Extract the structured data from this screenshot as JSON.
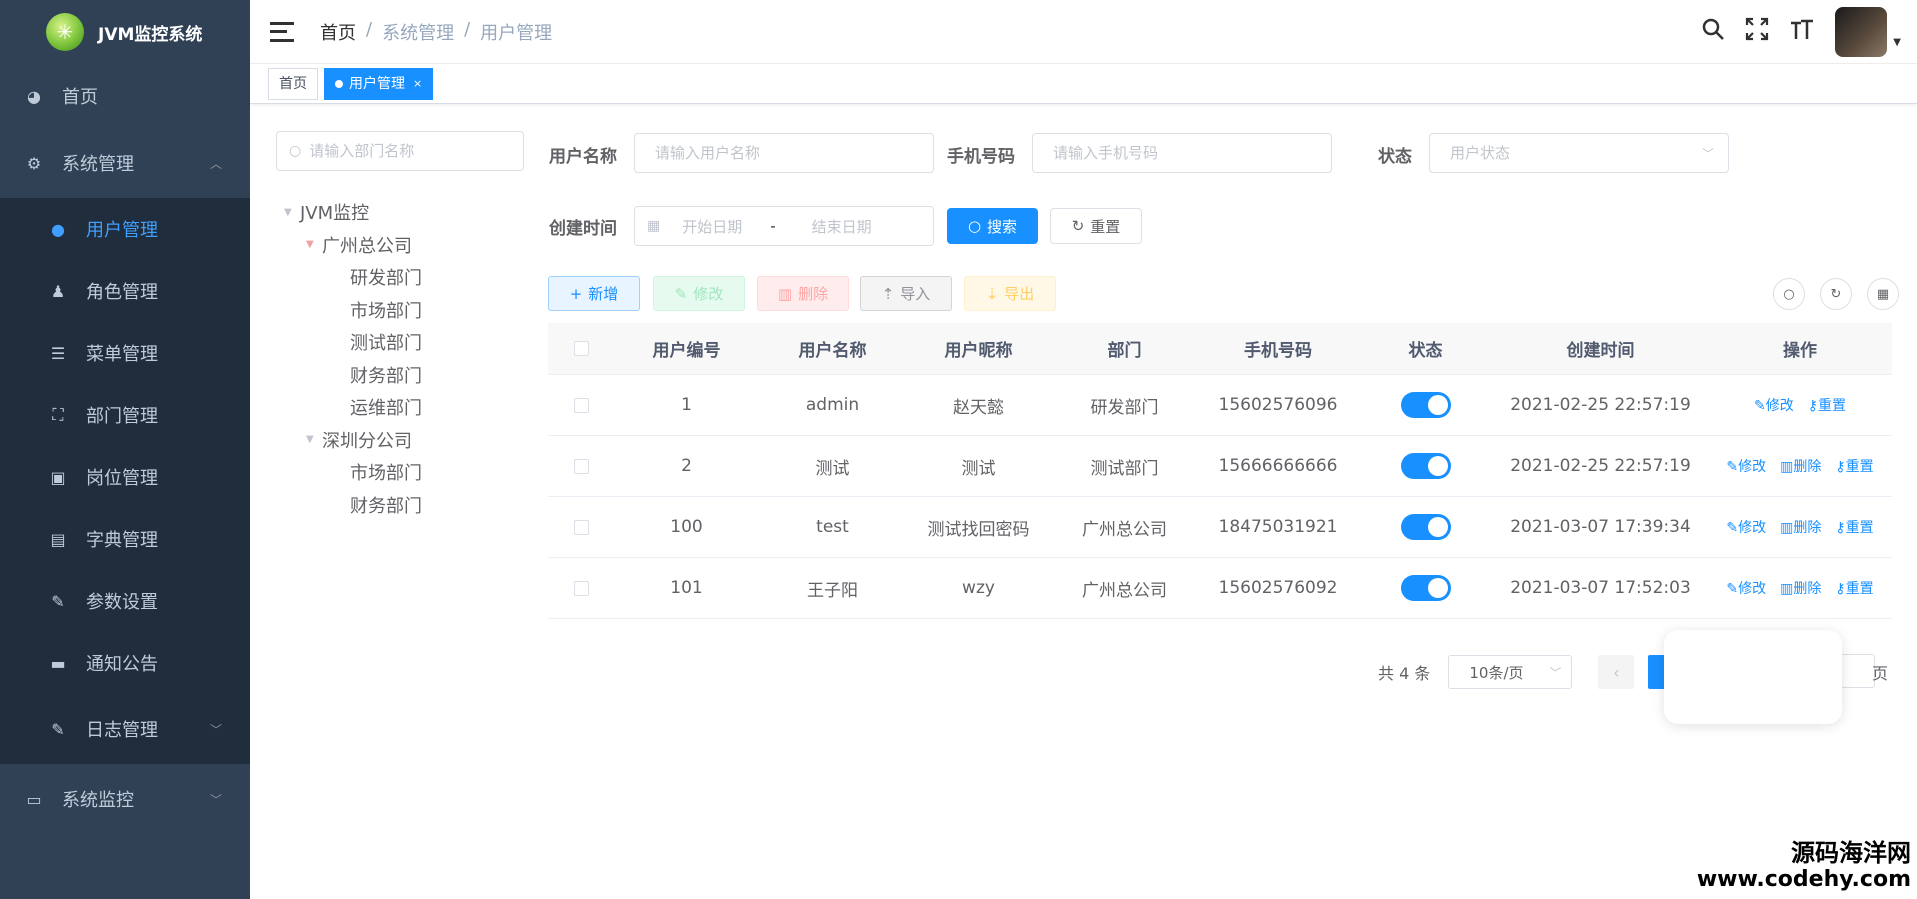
{
  "app": {
    "title": "JVM监控系统"
  },
  "sidebar": {
    "home": "首页",
    "system": "系统管理",
    "items": [
      {
        "label": "用户管理",
        "icon": "user-icon"
      },
      {
        "label": "角色管理",
        "icon": "role-icon"
      },
      {
        "label": "菜单管理",
        "icon": "menu-tree-icon"
      },
      {
        "label": "部门管理",
        "icon": "org-icon"
      },
      {
        "label": "岗位管理",
        "icon": "post-icon"
      },
      {
        "label": "字典管理",
        "icon": "dict-icon"
      },
      {
        "label": "参数设置",
        "icon": "edit-icon"
      },
      {
        "label": "通知公告",
        "icon": "message-icon"
      },
      {
        "label": "日志管理",
        "icon": "log-icon"
      }
    ],
    "monitor": "系统监控"
  },
  "breadcrumb": {
    "home": "首页",
    "sep": "/",
    "level1": "系统管理",
    "level2": "用户管理"
  },
  "tags": {
    "home": "首页",
    "current": "用户管理",
    "close": "×"
  },
  "tree": {
    "search_placeholder": "请输入部门名称",
    "nodes": {
      "root": "JVM监控",
      "gz": "广州总公司",
      "gz_rd": "研发部门",
      "gz_mk": "市场部门",
      "gz_qa": "测试部门",
      "gz_fin": "财务部门",
      "gz_ops": "运维部门",
      "sz": "深圳分公司",
      "sz_mk": "市场部门",
      "sz_fin": "财务部门"
    }
  },
  "form": {
    "username_label": "用户名称",
    "username_placeholder": "请输入用户名称",
    "phone_label": "手机号码",
    "phone_placeholder": "请输入手机号码",
    "status_label": "状态",
    "status_placeholder": "用户状态",
    "created_label": "创建时间",
    "start_placeholder": "开始日期",
    "range_sep": "-",
    "end_placeholder": "结束日期",
    "search_btn": "搜索",
    "reset_btn": "重置"
  },
  "toolbar": {
    "add": "新增",
    "edit": "修改",
    "delete": "删除",
    "import": "导入",
    "export": "导出"
  },
  "table": {
    "headers": {
      "id": "用户编号",
      "name": "用户名称",
      "nick": "用户昵称",
      "dept": "部门",
      "phone": "手机号码",
      "status": "状态",
      "time": "创建时间",
      "ops": "操作"
    },
    "op_edit": "修改",
    "op_delete": "删除",
    "op_reset": "重置",
    "rows": [
      {
        "id": "1",
        "name": "admin",
        "nick": "赵天懿",
        "dept": "研发部门",
        "phone": "15602576096",
        "status": true,
        "time": "2021-02-25 22:57:19"
      },
      {
        "id": "2",
        "name": "测试",
        "nick": "测试",
        "dept": "测试部门",
        "phone": "15666666666",
        "status": true,
        "time": "2021-02-25 22:57:19"
      },
      {
        "id": "100",
        "name": "test",
        "nick": "测试找回密码",
        "dept": "广州总公司",
        "phone": "18475031921",
        "status": true,
        "time": "2021-03-07 17:39:34"
      },
      {
        "id": "101",
        "name": "王子阳",
        "nick": "wzy",
        "dept": "广州总公司",
        "phone": "15602576092",
        "status": true,
        "time": "2021-03-07 17:52:03"
      }
    ]
  },
  "pager": {
    "total": "共 4 条",
    "page_size": "10条/页",
    "goto_suffix": "页"
  },
  "watermark": {
    "line1": "源码海洋网",
    "line2": "www.codehy.com"
  },
  "colors": {
    "sidebar": "#304156",
    "submenu": "#1f2d3d",
    "accent": "#1890ff"
  }
}
